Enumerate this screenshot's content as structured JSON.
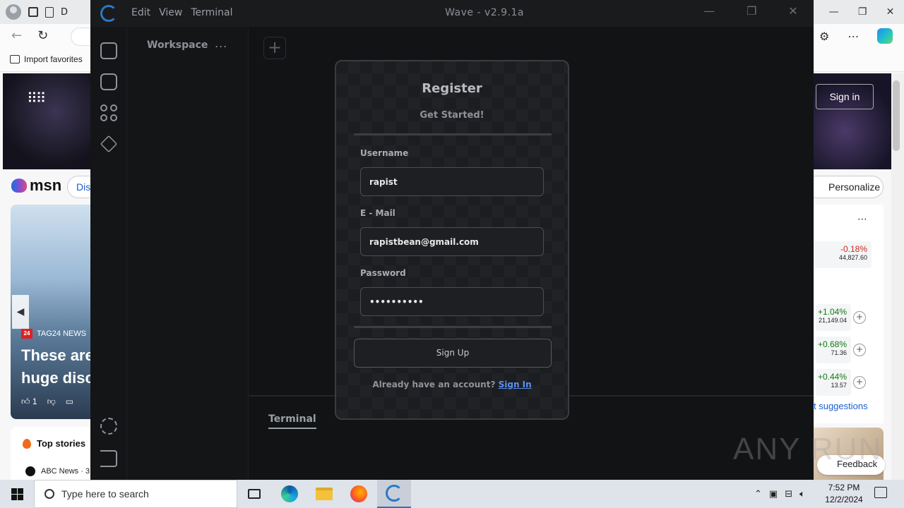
{
  "edge": {
    "tab_partial": "D",
    "favorites": {
      "import_label": "Import favorites"
    },
    "msn": {
      "logo": "msn",
      "discover_partial": "Dis",
      "card": {
        "source": "TAG24 NEWS",
        "source_badge": "24",
        "headline": "These are\nhuge disc",
        "likes": "1"
      },
      "top_stories": "Top stories",
      "abc_news": "ABC News · 3"
    },
    "right": {
      "sign_in": "Sign in",
      "personalize": "Personalize",
      "stocks": [
        {
          "pct": "-0.18%",
          "value": "44,827.60",
          "trend": "neg"
        },
        {
          "pct": "+1.04%",
          "value": "21,149.04",
          "trend": "pos"
        },
        {
          "pct": "+0.68%",
          "value": "71.36",
          "trend": "pos"
        },
        {
          "pct": "+0.44%",
          "value": "13.57",
          "trend": "pos"
        }
      ],
      "suggestions": "t suggestions",
      "feedback": "Feedback"
    }
  },
  "wave": {
    "menu": [
      "Edit",
      "View",
      "Terminal"
    ],
    "title": "Wave - v2.9.1a",
    "workspace": "Workspace",
    "workspace_more": "...",
    "terminal_tab": "Terminal",
    "sidebar_icons": [
      "workspace-icon",
      "bot-icon",
      "apps-icon",
      "layers-icon",
      "settings-icon",
      "logout-icon"
    ]
  },
  "register": {
    "title": "Register",
    "subtitle": "Get Started!",
    "username_label": "Username",
    "username_value": "rapist",
    "email_label": "E - Mail",
    "email_value": "rapistbean@gmail.com",
    "password_label": "Password",
    "password_value": "••••••••••",
    "submit": "Sign Up",
    "footer_text": "Already have an account?",
    "footer_link": "Sign In"
  },
  "watermark": "ANY RUN",
  "taskbar": {
    "search_placeholder": "Type here to search",
    "time": "7:52 PM",
    "date": "12/2/2024"
  },
  "colors": {
    "wave_bg": "#101113",
    "modal_bg": "#1c1d20",
    "link": "#5b8ff0",
    "taskbar": "#dfe3ea"
  }
}
